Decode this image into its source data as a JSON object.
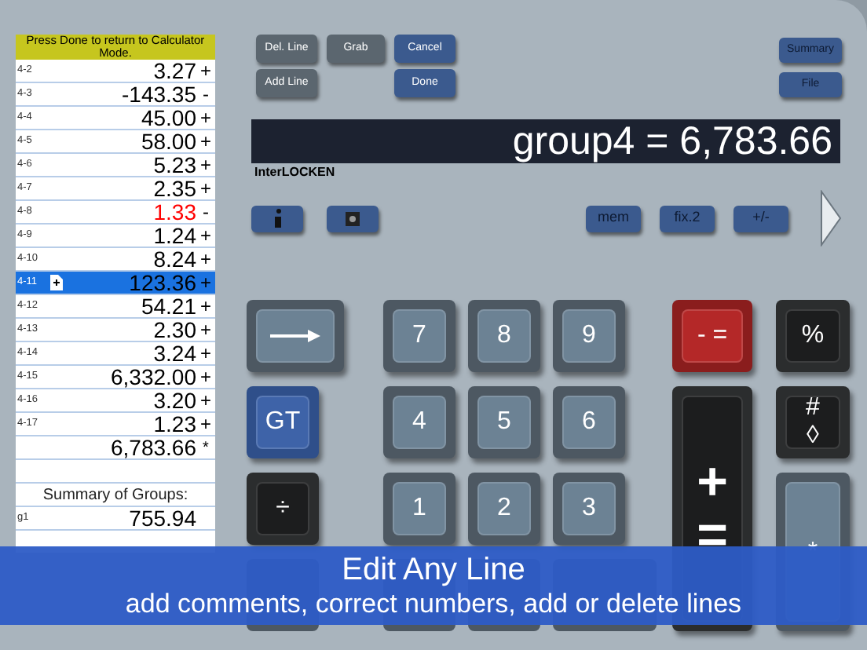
{
  "tape": {
    "notice": "Press Done to return to Calculator Mode.",
    "rows": [
      {
        "kind": "entry",
        "label": "4-2",
        "value": "3.27",
        "sign": "+",
        "selected": false,
        "color": "#000000"
      },
      {
        "kind": "entry",
        "label": "4-3",
        "value": "-143.35",
        "sign": "-",
        "selected": false,
        "color": "#000000"
      },
      {
        "kind": "entry",
        "label": "4-4",
        "value": "45.00",
        "sign": "+",
        "selected": false,
        "color": "#000000"
      },
      {
        "kind": "entry",
        "label": "4-5",
        "value": "58.00",
        "sign": "+",
        "selected": false,
        "color": "#000000"
      },
      {
        "kind": "entry",
        "label": "4-6",
        "value": "5.23",
        "sign": "+",
        "selected": false,
        "color": "#000000"
      },
      {
        "kind": "entry",
        "label": "4-7",
        "value": "2.35",
        "sign": "+",
        "selected": false,
        "color": "#000000"
      },
      {
        "kind": "entry",
        "label": "4-8",
        "value": "1.33",
        "sign": "-",
        "selected": false,
        "color": "#ff0000"
      },
      {
        "kind": "entry",
        "label": "4-9",
        "value": "1.24",
        "sign": "+",
        "selected": false,
        "color": "#000000"
      },
      {
        "kind": "entry",
        "label": "4-10",
        "value": "8.24",
        "sign": "+",
        "selected": false,
        "color": "#000000"
      },
      {
        "kind": "entry",
        "label": "4-11",
        "value": "123.36",
        "sign": "+",
        "selected": true
      },
      {
        "kind": "entry",
        "label": "4-12",
        "value": "54.21",
        "sign": "+",
        "selected": false,
        "color": "#000000"
      },
      {
        "kind": "entry",
        "label": "4-13",
        "value": "2.30",
        "sign": "+",
        "selected": false,
        "color": "#000000"
      },
      {
        "kind": "entry",
        "label": "4-14",
        "value": "3.24",
        "sign": "+",
        "selected": false,
        "color": "#000000"
      },
      {
        "kind": "entry",
        "label": "4-15",
        "value": "6,332.00",
        "sign": "+",
        "selected": false,
        "color": "#000000"
      },
      {
        "kind": "entry",
        "label": "4-16",
        "value": "3.20",
        "sign": "+",
        "selected": false,
        "color": "#000000"
      },
      {
        "kind": "entry",
        "label": "4-17",
        "value": "1.23",
        "sign": "+",
        "selected": false,
        "color": "#000000"
      },
      {
        "kind": "total",
        "value": "6,783.66",
        "sign": "*"
      },
      {
        "kind": "blank"
      },
      {
        "kind": "heading",
        "text": "Summary of Groups:"
      },
      {
        "kind": "entry",
        "label": "g1",
        "value": "755.94",
        "selected": false,
        "color": "#000000"
      }
    ]
  },
  "edit_buttons": [
    {
      "label": "Del. Line"
    },
    {
      "label": "Grab"
    },
    {
      "label": "Cancel"
    },
    {
      "label": "Add Line"
    },
    {
      "label": "Done"
    }
  ],
  "side_buttons": [
    {
      "label": "Summary"
    },
    {
      "label": "File"
    }
  ],
  "display": "group4 = 6,783.66",
  "brand": "InterLOCKEN",
  "function_buttons": [
    {
      "label": "mem"
    },
    {
      "label": "fix.2"
    },
    {
      "label": "+/-"
    }
  ],
  "keys": [
    {
      "kind": "arrow"
    },
    {
      "kind": "text",
      "label": "7"
    },
    {
      "kind": "text",
      "label": "8"
    },
    {
      "kind": "text",
      "label": "9"
    },
    {
      "kind": "text",
      "label": "- ="
    },
    {
      "kind": "text",
      "label": "%"
    },
    {
      "kind": "text",
      "label": "GT"
    },
    {
      "kind": "text",
      "label": "4"
    },
    {
      "kind": "text",
      "label": "5"
    },
    {
      "kind": "text",
      "label": "6"
    },
    {
      "kind": "plus-equals",
      "label": "+\n="
    },
    {
      "kind": "text",
      "label": "#\n◊"
    },
    {
      "kind": "text",
      "label": "÷"
    },
    {
      "kind": "text",
      "label": "1"
    },
    {
      "kind": "text",
      "label": "2"
    },
    {
      "kind": "text",
      "label": "3"
    },
    {
      "kind": "text",
      "label": "*"
    }
  ],
  "banner": {
    "title": "Edit Any Line",
    "subtitle": "add comments, correct numbers, add or delete lines"
  }
}
